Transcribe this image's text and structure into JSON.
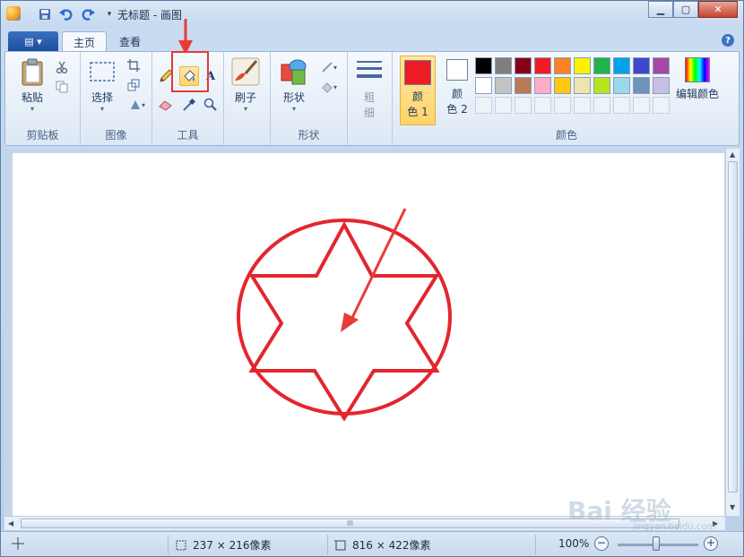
{
  "titlebar": {
    "title": "无标题 - 画图",
    "minimize_label": "▁",
    "maximize_label": "▢",
    "close_label": "✕"
  },
  "tabs": {
    "file_menu": "▤ ▾",
    "home": "主页",
    "view": "查看",
    "help": "?"
  },
  "ribbon": {
    "clipboard": {
      "paste": "粘贴",
      "group_label": "剪贴板"
    },
    "image": {
      "select": "选择",
      "group_label": "图像"
    },
    "tools": {
      "group_label": "工具",
      "text_tool": "A"
    },
    "brushes": {
      "label": "刷子"
    },
    "shapes": {
      "label": "形状",
      "group_label": "形状"
    },
    "size": {
      "label_line1": "粗",
      "label_line2": "细"
    },
    "colors": {
      "color1_line1": "颜",
      "color1_line2": "色 1",
      "color2_line1": "颜",
      "color2_line2": "色 2",
      "edit_colors": "编辑颜色",
      "group_label": "颜色",
      "color1_value": "#ed1c24",
      "color2_value": "#ffffff",
      "palette_row1": [
        "#000000",
        "#7f7f7f",
        "#880015",
        "#ed1c24",
        "#ff7f27",
        "#fff200",
        "#22b14c",
        "#00a2e8",
        "#3f48cc",
        "#a349a4"
      ],
      "palette_row2": [
        "#ffffff",
        "#c3c3c3",
        "#b97a57",
        "#ffaec9",
        "#ffc90e",
        "#efe4b0",
        "#b5e61d",
        "#99d9ea",
        "#7092be",
        "#c8bfe7"
      ]
    }
  },
  "statusbar": {
    "selection_size": "237 × 216像素",
    "canvas_size": "816 × 422像素",
    "zoom": "100%",
    "zoom_out": "−",
    "zoom_in": "+"
  },
  "scroll": {
    "grip": "III"
  },
  "watermark": {
    "brand": "Bai 经验",
    "url": "jingyan.baidu.com"
  },
  "accent": {
    "highlight_box": "#e53935",
    "drawing_color": "#e3262e",
    "arrow_color": "#ea3a3a"
  }
}
